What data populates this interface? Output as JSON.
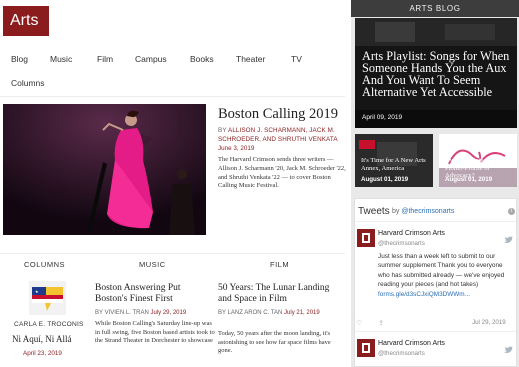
{
  "site": {
    "logo_text": "Arts"
  },
  "nav": {
    "items": [
      {
        "label": "Blog"
      },
      {
        "label": "Music"
      },
      {
        "label": "Film"
      },
      {
        "label": "Campus"
      },
      {
        "label": "Books"
      },
      {
        "label": "Theater"
      },
      {
        "label": "TV"
      },
      {
        "label": "Columns"
      }
    ]
  },
  "feature": {
    "title": "Boston Calling 2019",
    "byline_prefix": "By",
    "byline_authors": "ALLISON J. SCHARMANN, JACK M. SCHROEDER, and SHRUTHI VENKATA",
    "date": "June 3, 2019",
    "summary": "The Harvard Crimson sends three writers — Allison J. Scharmann '20, Jack M. Schroeder '22, and Shruthi Venkata '22 — to cover Boston Calling Music Festival."
  },
  "sections": {
    "columns": "COLUMNS",
    "music": "MUSIC",
    "film": "FILM"
  },
  "column_item": {
    "author": "CARLA E. TROCONIS",
    "title": "Ni Aquí, Ni Allá",
    "date": "April 23, 2019"
  },
  "music_item": {
    "title": "Boston Answering Put Boston's Finest First",
    "byline": "By VIVIEN L. TRAN",
    "date": "July 29, 2019",
    "summary": "While Boston Calling's Saturday line-up was in full swing, five Boston based artists took to the Strand Theater in Dorchester to showcase"
  },
  "film_item": {
    "title": "50 Years: The Lunar Landing and Space in Film",
    "byline": "By LANZ ARON C. TAN",
    "date": "July 21, 2019",
    "summary": "Today, 50 years after the moon landing, it's astonishing to see how far space films have gone."
  },
  "arts_blog": {
    "header": "ARTS BLOG",
    "main": {
      "title": "Arts Playlist: Songs for When Someone Hands You the Aux And You Want To Seem Alternative Yet Accessible",
      "date": "April 09, 2019"
    },
    "thumbs": [
      {
        "title": "It's Time for A New Arts Annex, America",
        "date": "August 01, 2019"
      },
      {
        "title": "Hypnotic Antagonist: Plotter-Profile or Advocacy?",
        "date": "August 01, 2019"
      }
    ]
  },
  "tweets": {
    "title": "Tweets",
    "by": "by",
    "handle": "@thecrimsonarts",
    "info": "i",
    "items": [
      {
        "name": "Harvard Crimson Arts",
        "handle": "@thecrimsonarts",
        "text": "Just less than a week left to submit to our summer supplement Thank you to everyone who has submitted already — we've enjoyed reading your pieces (and hot takes)",
        "link": "forms.gle/d3sCJxiQM3DWWm...",
        "actions": "♡ ⇪",
        "date": "Jul 29, 2019"
      },
      {
        "name": "Harvard Crimson Arts",
        "handle": "@thecrimsonarts"
      }
    ]
  },
  "colors": {
    "accent": "#8b1c1e",
    "blog_header": "#3d3d3d",
    "link": "#2a6fb5"
  }
}
